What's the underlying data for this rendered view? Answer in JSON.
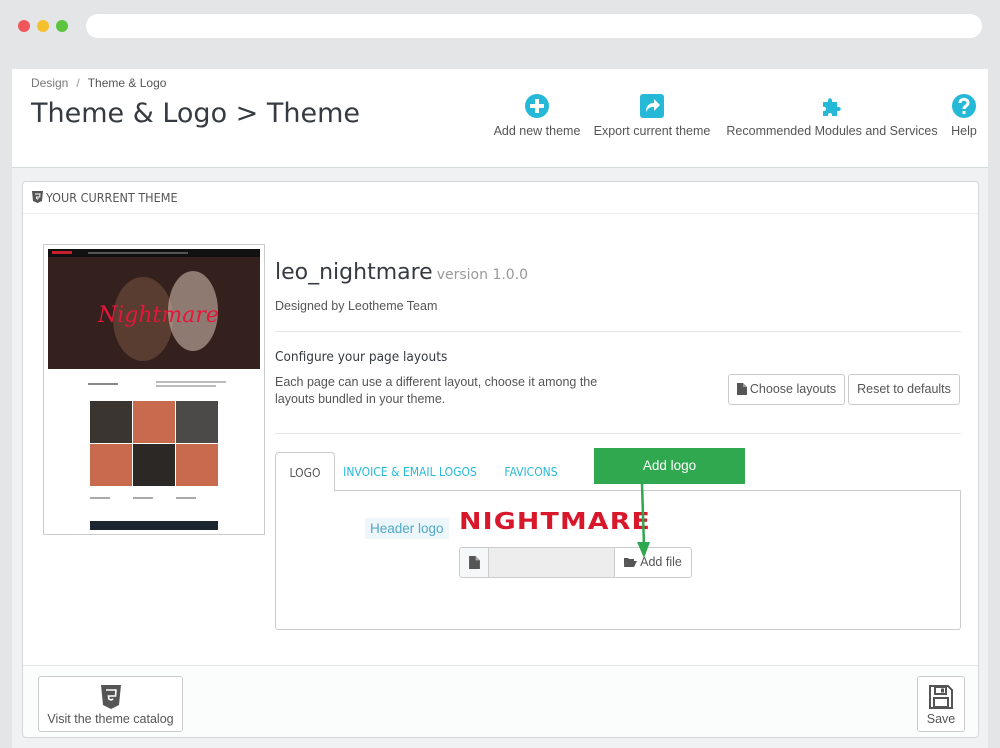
{
  "browser": {
    "url": ""
  },
  "breadcrumb": {
    "parent": "Design",
    "separator": "/",
    "current": "Theme & Logo"
  },
  "page": {
    "title": "Theme & Logo > Theme"
  },
  "toolbar": {
    "add_theme_label": "Add new theme",
    "export_theme_label": "Export current theme",
    "modules_label": "Recommended Modules and Services",
    "help_label": "Help"
  },
  "panel": {
    "heading": "YOUR CURRENT THEME"
  },
  "theme": {
    "name": "leo_nightmare",
    "version": "version 1.0.0",
    "designer": "Designed by Leotheme Team",
    "preview_text": "Nightmare"
  },
  "layouts": {
    "title": "Configure your page layouts",
    "description": "Each page can use a different layout, choose it among the layouts bundled in your theme.",
    "choose_label": "Choose layouts",
    "reset_label": "Reset to defaults"
  },
  "tabs": [
    {
      "label": "LOGO",
      "active": true
    },
    {
      "label": "INVOICE & EMAIL LOGOS",
      "active": false
    },
    {
      "label": "FAVICONS",
      "active": false
    }
  ],
  "logo": {
    "header_label": "Header logo",
    "logo_text": "NIGHTMARE",
    "file_value": "",
    "add_file_label": "Add file"
  },
  "callout": {
    "label": "Add logo"
  },
  "footer": {
    "catalog_label": "Visit the theme catalog",
    "save_label": "Save"
  },
  "colors": {
    "accent": "#25b9d7",
    "callout_green": "#2fa84f",
    "logo_red": "#d8172a"
  }
}
